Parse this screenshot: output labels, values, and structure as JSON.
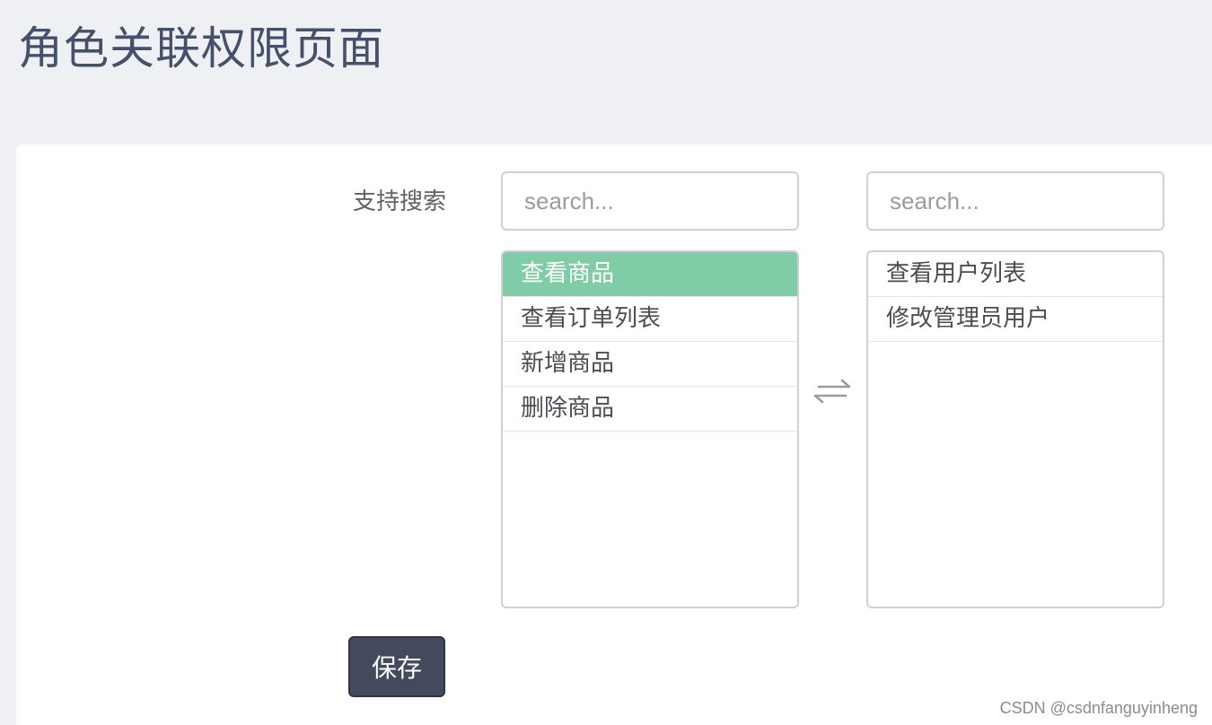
{
  "page": {
    "title": "角色关联权限页面"
  },
  "form": {
    "search_label": "支持搜索",
    "save_label": "保存"
  },
  "left_panel": {
    "search_placeholder": "search...",
    "items": [
      {
        "label": "查看商品",
        "selected": true
      },
      {
        "label": "查看订单列表",
        "selected": false
      },
      {
        "label": "新增商品",
        "selected": false
      },
      {
        "label": "删除商品",
        "selected": false
      }
    ]
  },
  "right_panel": {
    "search_placeholder": "search...",
    "items": [
      {
        "label": "查看用户列表",
        "selected": false
      },
      {
        "label": "修改管理员用户",
        "selected": false
      }
    ]
  },
  "icons": {
    "transfer": "transfer-arrows-icon"
  },
  "colors": {
    "selected_item_bg": "#80cca7",
    "primary_button_bg": "#434a5e",
    "title_text": "#45506a",
    "page_bg": "#eff0f4"
  },
  "watermark": "CSDN @csdnfanguyinheng"
}
